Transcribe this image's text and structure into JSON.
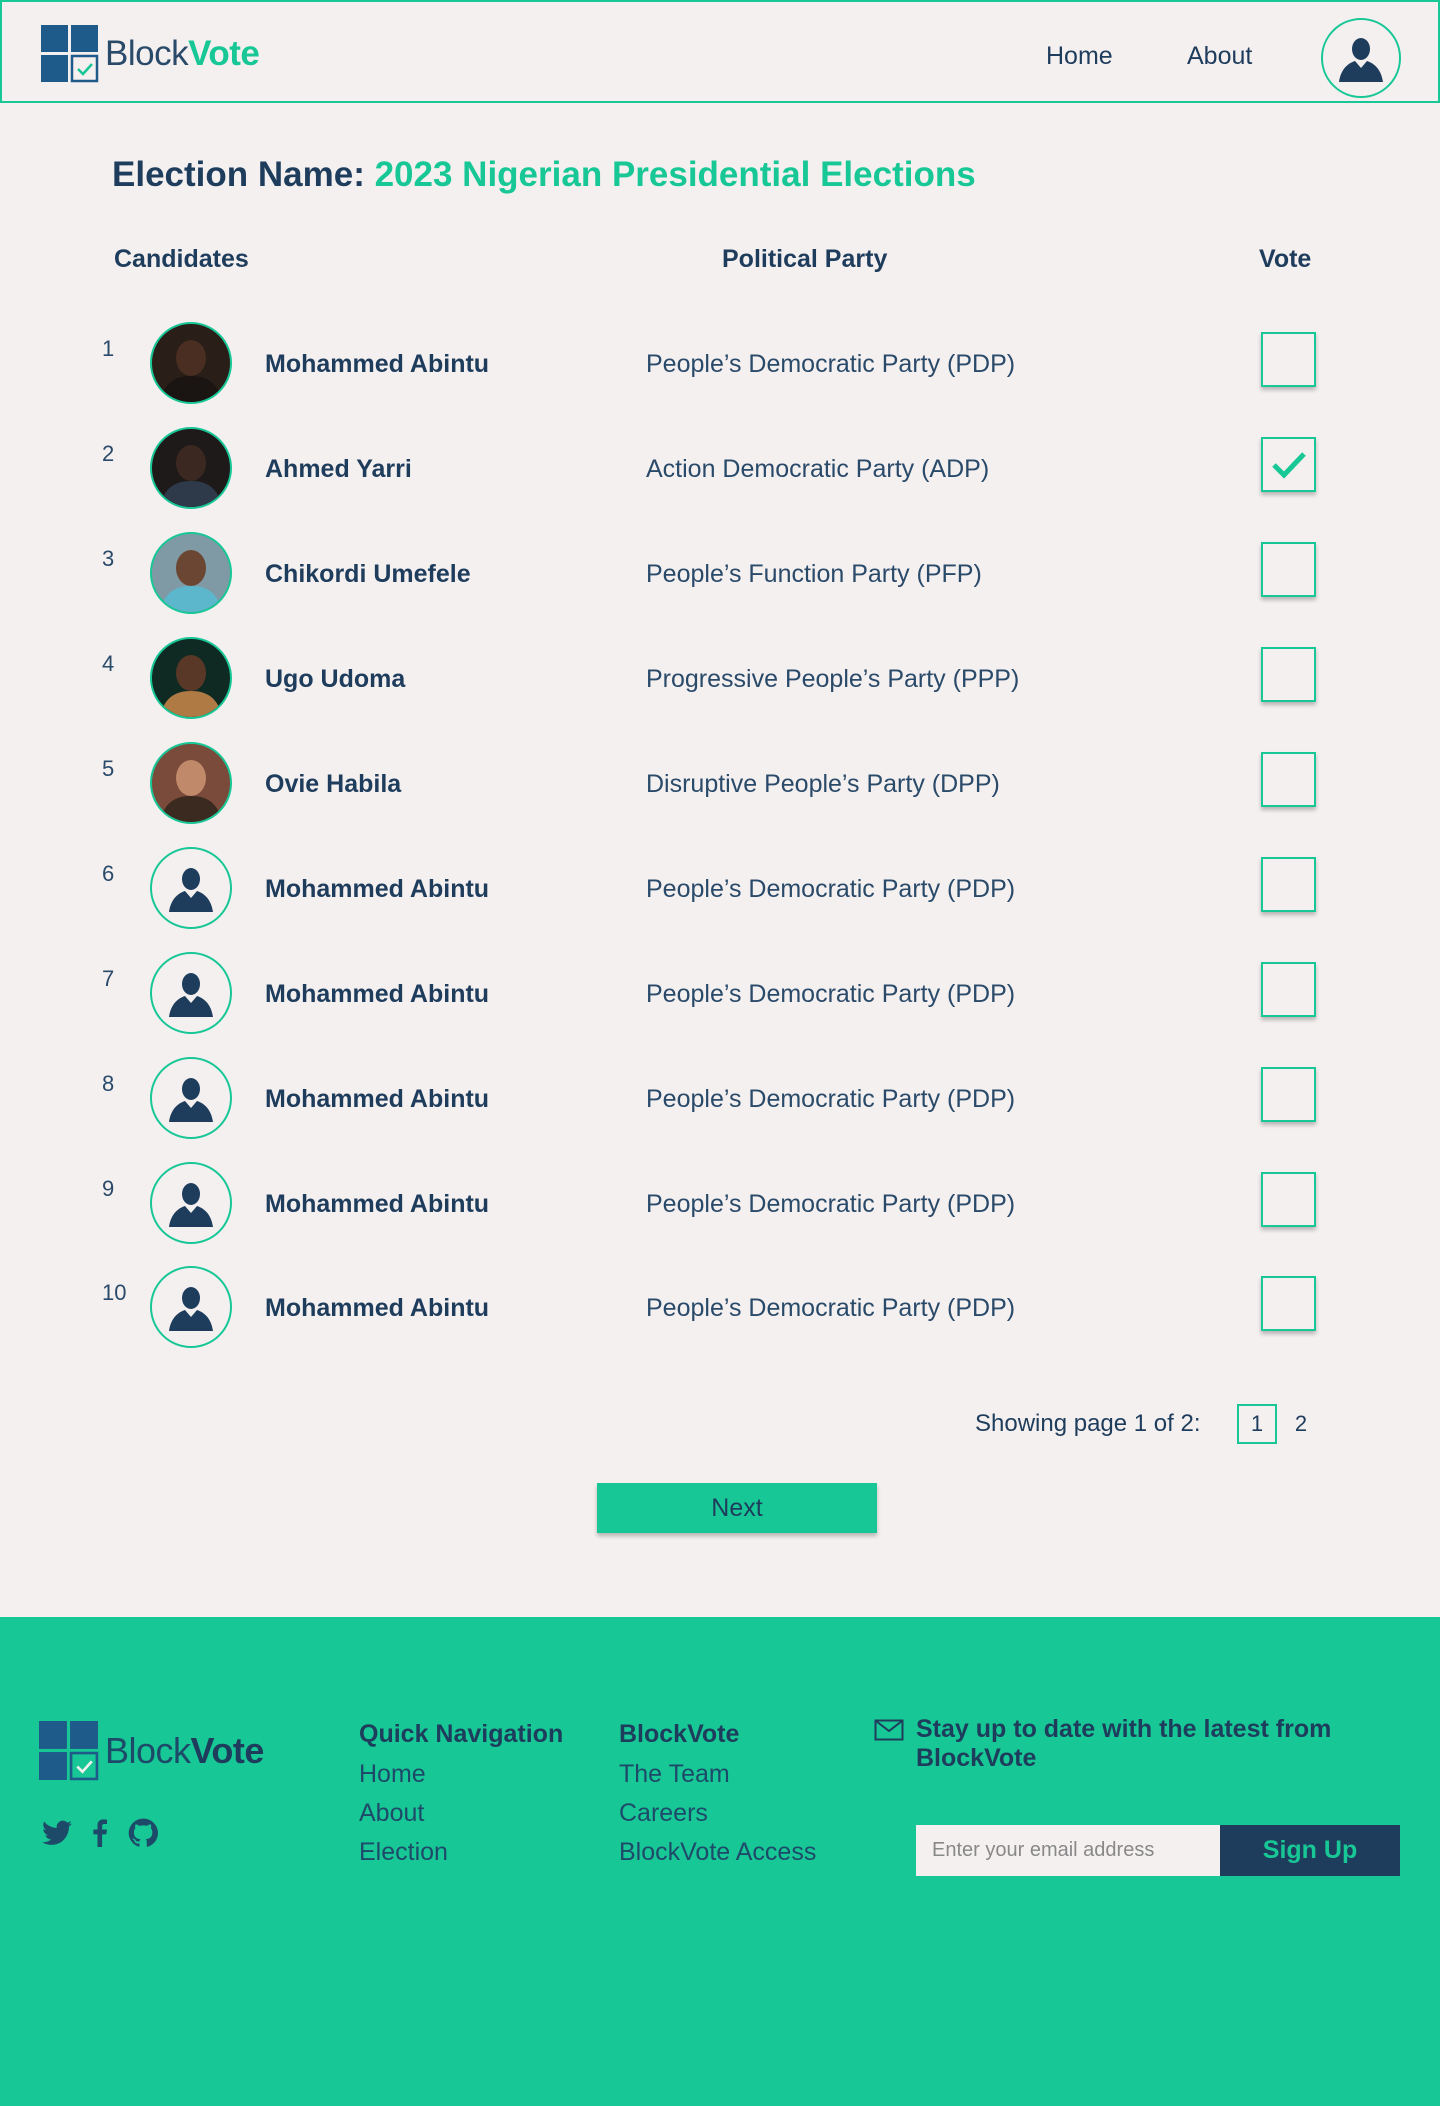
{
  "brand": {
    "name_plain": "Block",
    "name_accent": "Vote",
    "accent_color": "#17c795",
    "primary_color": "#1e3c5c"
  },
  "nav": {
    "home": "Home",
    "about": "About",
    "avatar_icon": "user-icon"
  },
  "election": {
    "label": "Election Name:",
    "name": "2023 Nigerian Presidential Elections"
  },
  "columns": {
    "candidates": "Candidates",
    "party": "Political Party",
    "vote": "Vote"
  },
  "candidates": [
    {
      "num": "1",
      "name": "Mohammed Abintu",
      "party": "People’s Democratic Party (PDP)",
      "photo": true,
      "selected": false
    },
    {
      "num": "2",
      "name": "Ahmed Yarri",
      "party": "Action Democratic Party (ADP)",
      "photo": true,
      "selected": true
    },
    {
      "num": "3",
      "name": "Chikordi Umefele",
      "party": "People’s Function Party (PFP)",
      "photo": true,
      "selected": false
    },
    {
      "num": "4",
      "name": "Ugo Udoma",
      "party": "Progressive People’s Party (PPP)",
      "photo": true,
      "selected": false
    },
    {
      "num": "5",
      "name": "Ovie Habila",
      "party": "Disruptive People’s Party (DPP)",
      "photo": true,
      "selected": false
    },
    {
      "num": "6",
      "name": "Mohammed Abintu",
      "party": "People’s Democratic Party (PDP)",
      "photo": false,
      "selected": false
    },
    {
      "num": "7",
      "name": "Mohammed Abintu",
      "party": "People’s Democratic Party (PDP)",
      "photo": false,
      "selected": false
    },
    {
      "num": "8",
      "name": "Mohammed Abintu",
      "party": "People’s Democratic Party (PDP)",
      "photo": false,
      "selected": false
    },
    {
      "num": "9",
      "name": "Mohammed Abintu",
      "party": "People’s Democratic Party (PDP)",
      "photo": false,
      "selected": false
    },
    {
      "num": "10",
      "name": "Mohammed Abintu",
      "party": "People’s Democratic Party (PDP)",
      "photo": false,
      "selected": false
    }
  ],
  "pagination": {
    "info": "Showing page 1 of 2:",
    "pages": [
      "1",
      "2"
    ],
    "current": "1"
  },
  "next_label": "Next",
  "footer": {
    "col1": {
      "title": "Quick Navigation",
      "links": [
        "Home",
        "About",
        "Election"
      ]
    },
    "col2": {
      "title": "BlockVote",
      "links": [
        "The Team",
        "Careers",
        "BlockVote Access"
      ]
    },
    "newsletter": "Stay up to date with the latest from BlockVote",
    "email_placeholder": "Enter your email address",
    "signup": "Sign Up",
    "socials": [
      "twitter-icon",
      "facebook-icon",
      "github-icon"
    ]
  }
}
